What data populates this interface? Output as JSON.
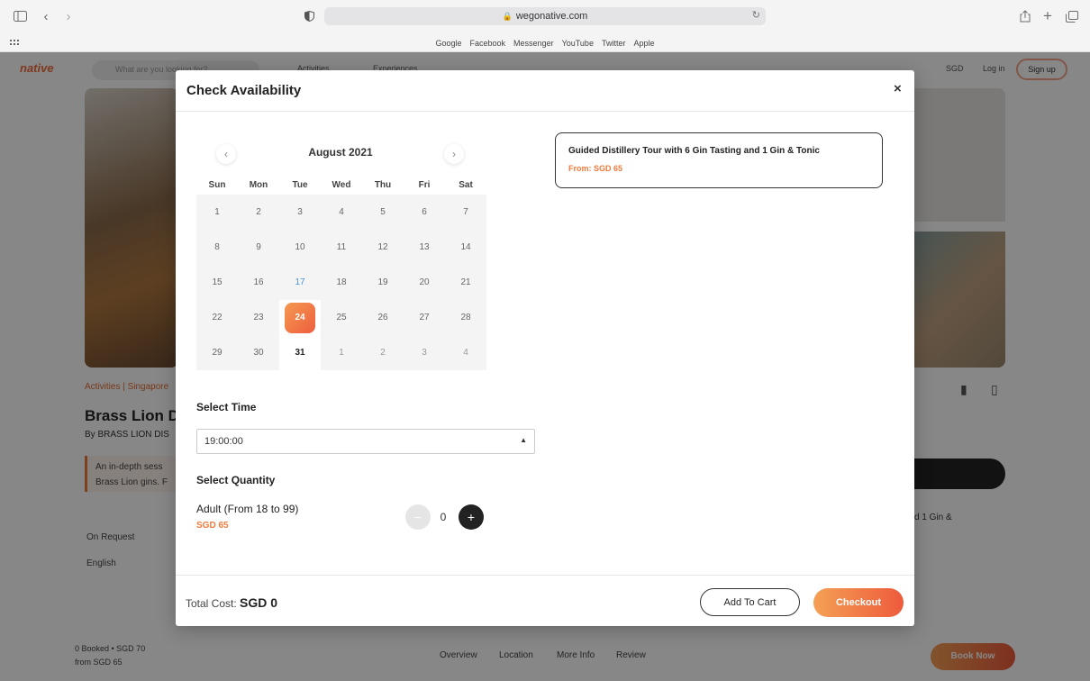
{
  "browser": {
    "url": "wegonative.com",
    "bookmarks": [
      "Google",
      "Facebook",
      "Messenger",
      "YouTube",
      "Twitter",
      "Apple"
    ]
  },
  "background": {
    "logo": "native",
    "search_placeholder": "What are you looking for?",
    "nav": [
      "Activities",
      "Experiences"
    ],
    "currency": "SGD",
    "login": "Log in",
    "signup": "Sign up",
    "breadcrumb": "Activities | Singapore",
    "title": "Brass Lion Di",
    "byline": "By BRASS LION DIS",
    "desc_line1": "An in-depth sess",
    "desc_line2": "Brass Lion gins. F",
    "on_request": "On Request",
    "language": "English",
    "side_text": "d 1 Gin &",
    "booked": "0 Booked • SGD 70",
    "from": "from SGD 65",
    "tabs": [
      "Overview",
      "Location",
      "More Info",
      "Review"
    ],
    "book_now": "Book Now"
  },
  "modal": {
    "title": "Check Availability",
    "close": "×",
    "calendar": {
      "month": "August 2021",
      "weekdays": [
        "Sun",
        "Mon",
        "Tue",
        "Wed",
        "Thu",
        "Fri",
        "Sat"
      ],
      "days": [
        "1",
        "2",
        "3",
        "4",
        "5",
        "6",
        "7",
        "8",
        "9",
        "10",
        "11",
        "12",
        "13",
        "14",
        "15",
        "16",
        "17",
        "18",
        "19",
        "20",
        "21",
        "22",
        "23",
        "24",
        "25",
        "26",
        "27",
        "28",
        "29",
        "30",
        "31",
        "1",
        "2",
        "3",
        "4"
      ],
      "today": "17",
      "selected": "24"
    },
    "select_time_label": "Select Time",
    "time_value": "19:00:00",
    "select_quantity_label": "Select Quantity",
    "ticket": {
      "name": "Adult (From 18 to 99)",
      "price": "SGD 65",
      "quantity": "0"
    },
    "product": {
      "title": "Guided Distillery Tour with 6 Gin Tasting and 1 Gin & Tonic",
      "price": "From: SGD 65"
    },
    "footer": {
      "total_label": "Total Cost:",
      "total_value": "SGD 0",
      "add_to_cart": "Add To Cart",
      "checkout": "Checkout"
    }
  }
}
